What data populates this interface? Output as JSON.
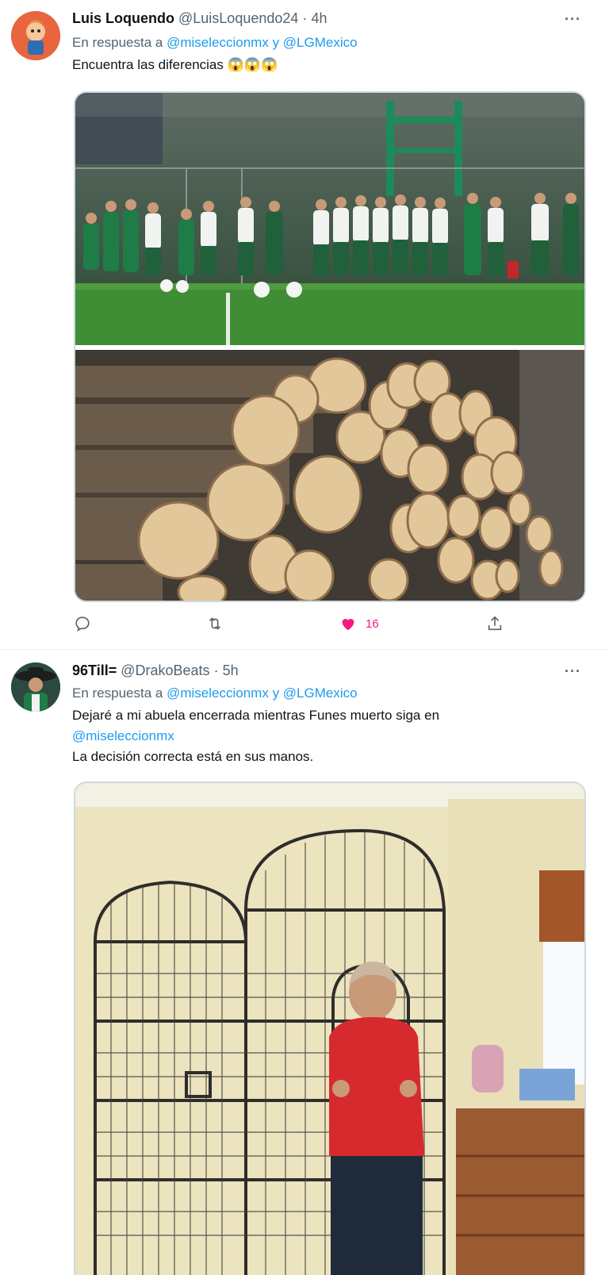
{
  "tweets": [
    {
      "author_name": "Luis Loquendo",
      "handle": "@LuisLoquendo24",
      "dot": "·",
      "time": "4h",
      "reply_prefix": "En respuesta a",
      "reply_to_1": "@miseleccionmx",
      "reply_conj": "y",
      "reply_to_2": "@LGMexico",
      "text_line_1": "Encuentra las diferencias",
      "emojis": "😱😱😱",
      "likes": "16"
    },
    {
      "author_name": "96Till=",
      "handle": "@DrakoBeats",
      "dot": "·",
      "time": "5h",
      "reply_prefix": "En respuesta a",
      "reply_to_1": "@miseleccionmx",
      "reply_conj": "y",
      "reply_to_2": "@LGMexico",
      "text_line_1": "Dejaré a mi abuela encerrada mientras Funes muerto siga en",
      "text_mention": "@miseleccionmx",
      "text_line_3": "La decisión correcta está en sus manos."
    }
  ],
  "more_glyph": "···",
  "colors": {
    "link": "#1d9bf0",
    "muted": "#536471",
    "like": "#f91880",
    "text": "#0f1419"
  },
  "icons": [
    "reply-icon",
    "retweet-icon",
    "like-icon",
    "share-icon",
    "more-icon"
  ]
}
